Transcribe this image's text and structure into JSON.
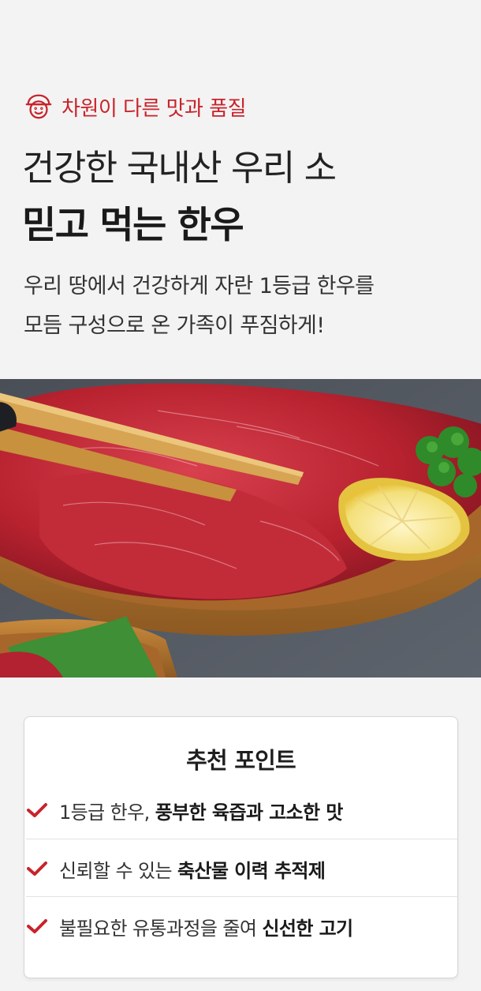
{
  "header": {
    "eyebrow_icon": "chef-face-icon",
    "eyebrow": "차원이 다른 맛과 품질",
    "title_line1": "건강한 국내산 우리 소",
    "title_line2": "믿고 먹는 한우",
    "desc_line1": "우리 땅에서 건강하게 자란 1등급 한우를",
    "desc_line2": "모듬 구성으로 온 가족이 푸짐하게!"
  },
  "photo": {
    "icon": "beef-platter-photo"
  },
  "card": {
    "title": "추천 포인트",
    "points": [
      {
        "icon": "check-icon",
        "plain": "1등급 한우, ",
        "bold": "풍부한 육즙과 고소한 맛"
      },
      {
        "icon": "check-icon",
        "plain": "신뢰할 수 있는 ",
        "bold": "축산물 이력 추적제"
      },
      {
        "icon": "check-icon",
        "plain": "불필요한 유통과정을 줄여 ",
        "bold": "신선한 고기"
      }
    ]
  },
  "colors": {
    "accent": "#c8232b",
    "background": "#f3f3f3"
  }
}
